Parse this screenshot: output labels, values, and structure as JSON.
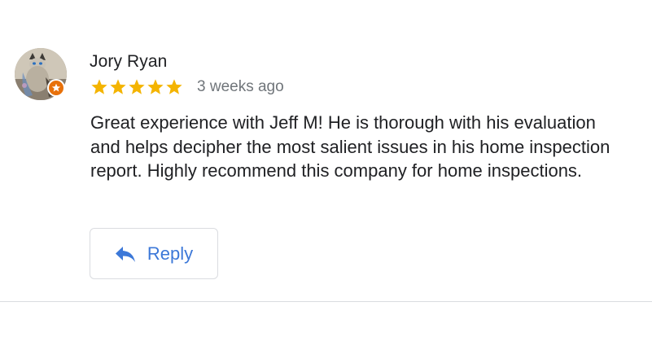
{
  "review": {
    "author": "Jory Ryan",
    "rating": 5,
    "max_rating": 5,
    "time": "3 weeks ago",
    "text": "Great experience with Jeff M! He is thorough with his evaluation and helps decipher the most salient issues in his home inspection report. Highly recommend this company for home inspections.",
    "reply_label": "Reply"
  },
  "icons": {
    "avatar": "avatar-cat-photo",
    "badge": "local-guide-badge-icon",
    "star": "star-icon",
    "reply": "reply-arrow-icon"
  },
  "colors": {
    "star": "#f4b400",
    "reply_accent": "#3c78d8",
    "badge": "#e8710a",
    "divider": "#dadce0",
    "text": "#202124",
    "muted": "#70757a"
  }
}
